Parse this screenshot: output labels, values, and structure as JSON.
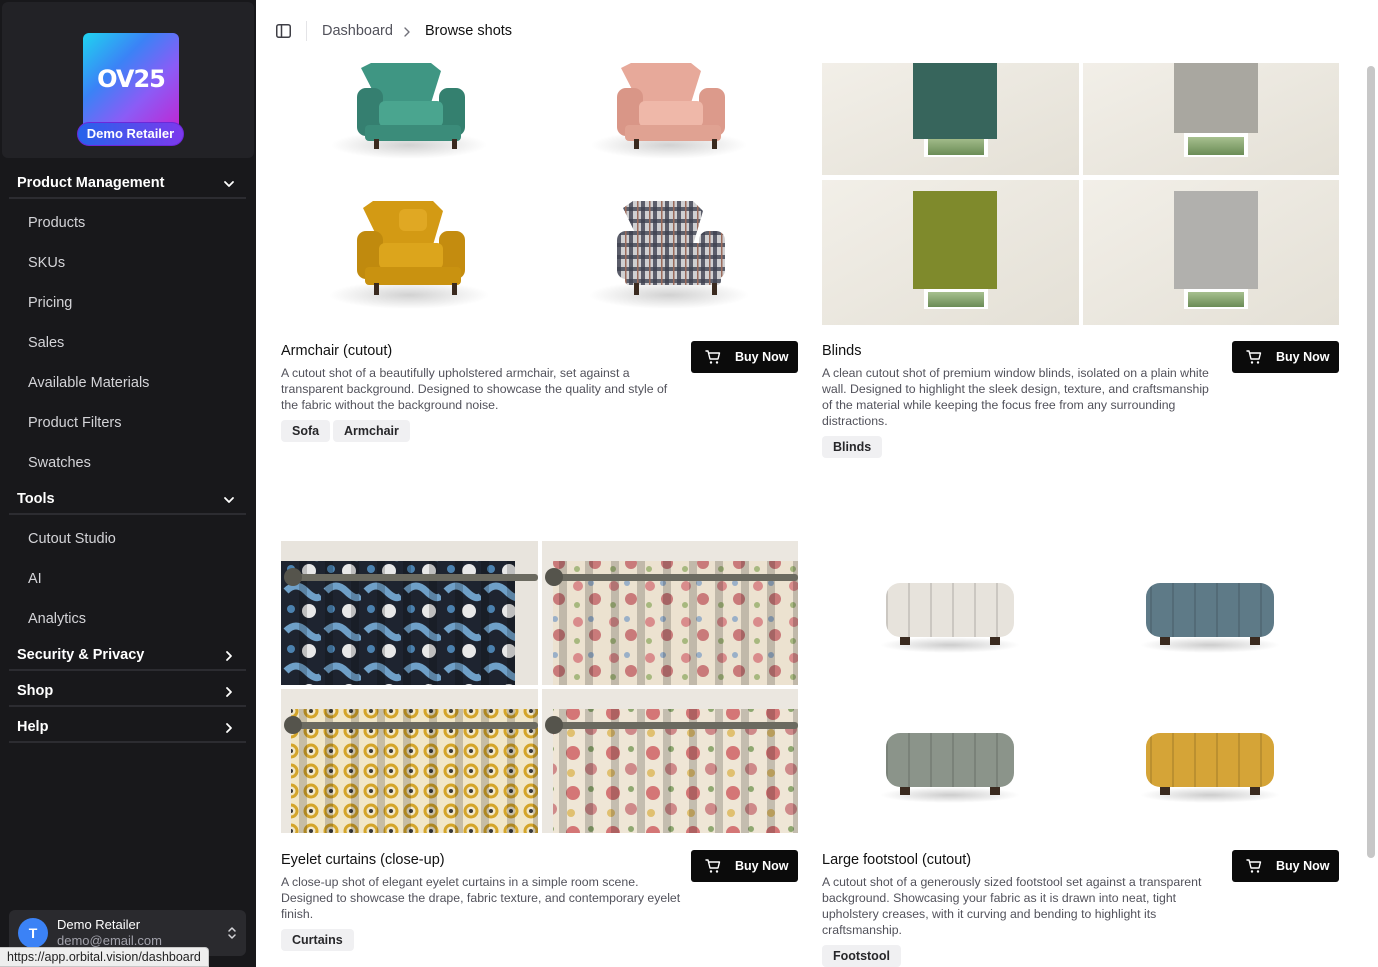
{
  "sidebar": {
    "logo_text": "OV25",
    "retailer_badge": "Demo Retailer",
    "groups": [
      {
        "label": "Product Management",
        "expanded": true,
        "items": [
          "Products",
          "SKUs",
          "Pricing",
          "Sales",
          "Available Materials",
          "Product Filters",
          "Swatches"
        ]
      },
      {
        "label": "Tools",
        "expanded": true,
        "items": [
          "Cutout Studio",
          "AI",
          "Analytics"
        ]
      },
      {
        "label": "Security & Privacy",
        "expanded": false
      },
      {
        "label": "Shop",
        "expanded": false
      },
      {
        "label": "Help",
        "expanded": false
      }
    ],
    "user": {
      "initial": "T",
      "name": "Demo Retailer",
      "email": "demo@email.com"
    }
  },
  "status_url": "https://app.orbital.vision/dashboard",
  "header": {
    "breadcrumb": [
      "Dashboard",
      "Browse shots"
    ]
  },
  "buy_label": "Buy Now",
  "cards": [
    {
      "title": "Armchair (cutout)",
      "description": "A cutout shot of a beautifully upholstered armchair, set against a transparent background. Designed to showcase the quality and style of the fabric without the background noise.",
      "tags": [
        "Sofa",
        "Armchair"
      ],
      "variant_colors": [
        "#3f9683",
        "#e3a393",
        "#d39a14",
        "#7b7d86"
      ]
    },
    {
      "title": "Blinds",
      "description": "A clean cutout shot of premium window blinds, isolated on a plain white wall. Designed to highlight the sleek design, texture, and craftsmanship of the material while keeping the focus free from any surrounding distractions.",
      "tags": [
        "Blinds"
      ],
      "variant_colors": [
        "#37655c",
        "#a9a7a0",
        "#7f8a2c",
        "#b1b0ad"
      ]
    },
    {
      "title": "Eyelet curtains (close-up)",
      "description": "A close-up shot of elegant eyelet curtains in a simple room scene. Designed to showcase the drape, fabric texture, and contemporary eyelet finish.",
      "tags": [
        "Curtains"
      ],
      "variant_colors": [
        "#2c4660",
        "#e6dccb",
        "#d9b33a",
        "#eadfcd"
      ]
    },
    {
      "title": "Large footstool (cutout)",
      "description": "A cutout shot of a generously sized footstool set against a transparent background. Showcasing your fabric as it is drawn into neat, tight upholstery creases, with it curving and bending to highlight its craftsmanship.",
      "tags": [
        "Footstool"
      ],
      "variant_colors": [
        "#e7e3dc",
        "#5e7a87",
        "#8b948a",
        "#d5a437"
      ]
    }
  ]
}
